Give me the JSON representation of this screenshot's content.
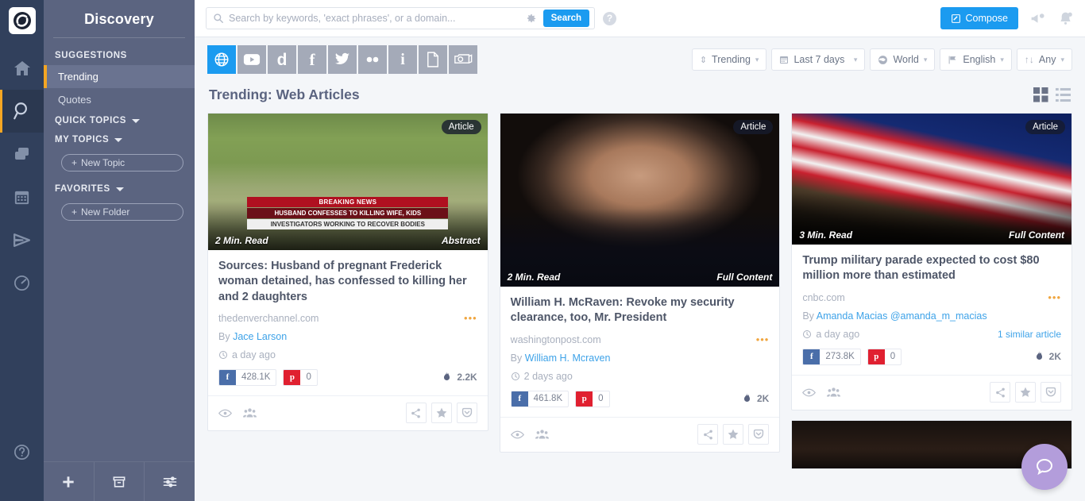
{
  "rail": {
    "logo": "app-logo",
    "items": [
      {
        "name": "home",
        "icon": "home-icon",
        "active": false
      },
      {
        "name": "discovery",
        "icon": "search-icon",
        "active": true
      },
      {
        "name": "publish",
        "icon": "layers-icon",
        "active": false
      },
      {
        "name": "calendar",
        "icon": "calendar-icon",
        "active": false
      },
      {
        "name": "engage",
        "icon": "send-icon",
        "active": false
      },
      {
        "name": "analytics",
        "icon": "gauge-icon",
        "active": false
      }
    ],
    "help_label": "?"
  },
  "sidebar": {
    "title": "Discovery",
    "sections": [
      {
        "label": "SUGGESTIONS",
        "caret": false
      },
      {
        "label": "QUICK TOPICS",
        "caret": true
      },
      {
        "label": "MY TOPICS",
        "caret": true
      },
      {
        "label": "FAVORITES",
        "caret": true
      }
    ],
    "suggestions": [
      {
        "label": "Trending",
        "active": true
      },
      {
        "label": "Quotes",
        "active": false
      }
    ],
    "new_topic_label": "New Topic",
    "new_folder_label": "New Folder",
    "footer": [
      {
        "name": "add-button",
        "icon": "plus-icon"
      },
      {
        "name": "archive-button",
        "icon": "archive-icon"
      },
      {
        "name": "filters-button",
        "icon": "sliders-icon"
      }
    ]
  },
  "topbar": {
    "search_placeholder": "Search by keywords, 'exact phrases', or a domain...",
    "search_value": "",
    "search_button": "Search",
    "settings_icon": "gear-icon",
    "help_icon": "help-icon",
    "compose_label": "Compose",
    "megaphone_icon": "megaphone-icon",
    "bell_icon": "bell-icon"
  },
  "source_tabs": [
    {
      "name": "web",
      "glyph": "globe-icon",
      "active": true
    },
    {
      "name": "youtube",
      "glyph": "youtube-icon",
      "active": false
    },
    {
      "name": "dailymotion",
      "glyph": "dailymotion-icon",
      "active": false
    },
    {
      "name": "facebook",
      "glyph": "facebook-icon",
      "active": false
    },
    {
      "name": "twitter",
      "glyph": "twitter-icon",
      "active": false
    },
    {
      "name": "flickr",
      "glyph": "flickr-icon",
      "active": false
    },
    {
      "name": "instagram",
      "glyph": "instagram-icon",
      "active": false
    },
    {
      "name": "documents",
      "glyph": "document-icon",
      "active": false
    },
    {
      "name": "images",
      "glyph": "camera-icon",
      "active": false
    }
  ],
  "filters": [
    {
      "name": "sort-filter",
      "icon": "sort-icon",
      "label": "Trending"
    },
    {
      "name": "date-filter",
      "icon": "calendar-icon",
      "label": "Last 7 days"
    },
    {
      "name": "region-filter",
      "icon": "globe-icon",
      "label": "World"
    },
    {
      "name": "language-filter",
      "icon": "flag-icon",
      "label": "English"
    },
    {
      "name": "type-filter",
      "icon": "updown-icon",
      "label": "Any"
    }
  ],
  "section": {
    "title": "Trending: Web Articles",
    "grid_view": "grid-view-icon",
    "list_view": "list-view-icon"
  },
  "cards": [
    {
      "badge": "Article",
      "read_time": "2 Min. Read",
      "content_type": "Abstract",
      "title": "Sources: Husband of pregnant Frederick woman detained, has confessed to killing her and 2 daughters",
      "domain": "thedenverchannel.com",
      "by_label": "By",
      "author": "Jace Larson",
      "time": "a day ago",
      "similar": "",
      "facebook": "428.1K",
      "pinterest": "0",
      "fire": "2.2K",
      "overlay": {
        "banner_top": "BREAKING NEWS",
        "banner_mid": "HUSBAND CONFESSES TO KILLING WIFE, KIDS",
        "banner_bottom": "INVESTIGATORS WORKING TO RECOVER BODIES"
      }
    },
    {
      "badge": "Article",
      "read_time": "2 Min. Read",
      "content_type": "Full Content",
      "title": "William H. McRaven: Revoke my security clearance, too, Mr. President",
      "domain": "washingtonpost.com",
      "by_label": "By",
      "author": "William H. Mcraven",
      "time": "2 days ago",
      "similar": "",
      "facebook": "461.8K",
      "pinterest": "0",
      "fire": "2K"
    },
    {
      "badge": "Article",
      "read_time": "3 Min. Read",
      "content_type": "Full Content",
      "title": "Trump military parade expected to cost $80 million more than estimated",
      "domain": "cnbc.com",
      "by_label": "By",
      "author": "Amanda Macias @amanda_m_macias",
      "time": "a day ago",
      "similar": "1 similar  article",
      "facebook": "273.8K",
      "pinterest": "0",
      "fire": "2K"
    }
  ],
  "card_actions": {
    "eye": "eye-icon",
    "people": "people-icon",
    "share": "share-icon",
    "star": "star-icon",
    "pocket": "pocket-icon"
  },
  "fab": {
    "icon": "chat-bubble-icon"
  },
  "colors": {
    "accent": "#1b9bf0",
    "sidebar": "#5b6480",
    "rail": "#31405c",
    "highlight": "#f5a623",
    "facebook": "#4a6ea9",
    "pinterest": "#e02030",
    "fab": "#b39ddb"
  }
}
